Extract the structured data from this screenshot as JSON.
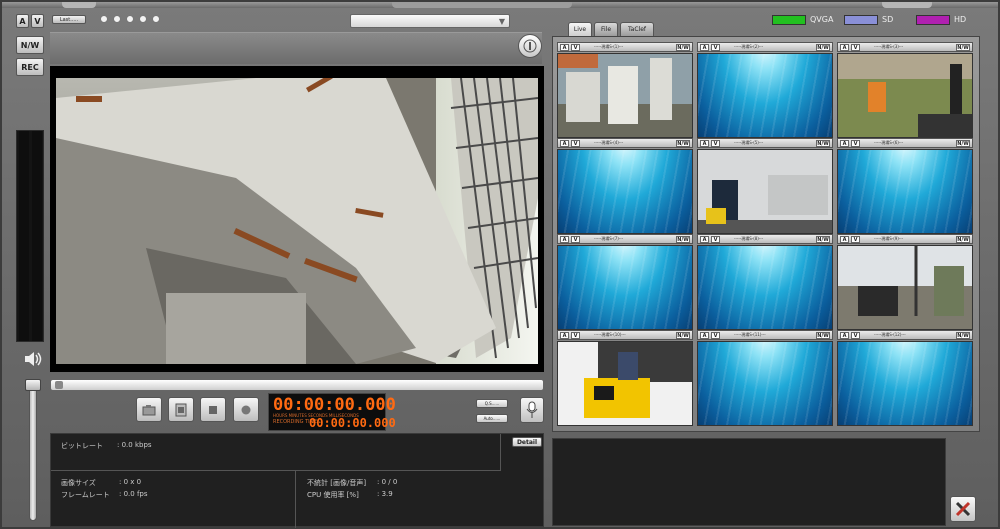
{
  "window": {
    "title": ""
  },
  "left": {
    "btn_a": "A",
    "btn_v": "V",
    "btn_nw": "N/W",
    "btn_rec": "REC",
    "speaker_icon": "speaker-icon"
  },
  "topbar": {
    "small_btn": "Last.....",
    "dots": 5,
    "select_value": ""
  },
  "controls": {
    "buttons": [
      "snapshot-icon",
      "record-file-icon",
      "stop-icon",
      "record-icon"
    ],
    "timer_main": "00:00:00.000",
    "timer_caps": "HOURS MINUTES SECONDS MILLISECONDS",
    "timer_rec_label": "RECORDING TIME",
    "timer_rec": "00:00:00.000",
    "mini1": "Q.S......",
    "mini2": "Auto......"
  },
  "stats": {
    "bitrate_label": "ビットレート",
    "bitrate_value": ": 0.0 kbps",
    "imgsize_label": "画像サイズ",
    "imgsize_value": ": 0 x 0",
    "framerate_label": "フレームレート",
    "framerate_value": ": 0.0 fps",
    "discard_label": "不統計 [画像/音声]",
    "discard_value": ": 0 / 0",
    "cpu_label": "CPU 使用率 [%]",
    "cpu_value": ": 3.9",
    "detail_btn": "Detail"
  },
  "legend": [
    {
      "label": "QVGA",
      "color": "#22c020"
    },
    {
      "label": "SD",
      "color": "#8a90d8"
    },
    {
      "label": "HD",
      "color": "#b020b0"
    }
  ],
  "tabs": [
    "Live",
    "File",
    "TaClef"
  ],
  "cells": [
    {
      "a": "A",
      "v": "V",
      "nw": "N/W",
      "name": "-----現場S-(1)---",
      "type": "cam1"
    },
    {
      "a": "A",
      "v": "V",
      "nw": "N/W",
      "name": "-----現場S-(2)---",
      "type": "blue"
    },
    {
      "a": "A",
      "v": "V",
      "nw": "N/W",
      "name": "-----現場S-(3)---",
      "type": "cam2"
    },
    {
      "a": "A",
      "v": "V",
      "nw": "N/W",
      "name": "-----現場S-(4)---",
      "type": "blue"
    },
    {
      "a": "A",
      "v": "V",
      "nw": "N/W",
      "name": "-----現場S-(5)---",
      "type": "cam3"
    },
    {
      "a": "A",
      "v": "V",
      "nw": "N/W",
      "name": "-----現場S-(6)---",
      "type": "blue"
    },
    {
      "a": "A",
      "v": "V",
      "nw": "N/W",
      "name": "-----現場S-(7)---",
      "type": "blue"
    },
    {
      "a": "A",
      "v": "V",
      "nw": "N/W",
      "name": "-----現場S-(8)---",
      "type": "blue"
    },
    {
      "a": "A",
      "v": "V",
      "nw": "N/W",
      "name": "-----現場S-(9)---",
      "type": "cam4"
    },
    {
      "a": "A",
      "v": "V",
      "nw": "N/W",
      "name": "-----現場S-(10)---",
      "type": "cam5"
    },
    {
      "a": "A",
      "v": "V",
      "nw": "N/W",
      "name": "-----現場S-(11)---",
      "type": "blue"
    },
    {
      "a": "A",
      "v": "V",
      "nw": "N/W",
      "name": "-----現場S-(12)---",
      "type": "blue"
    }
  ]
}
